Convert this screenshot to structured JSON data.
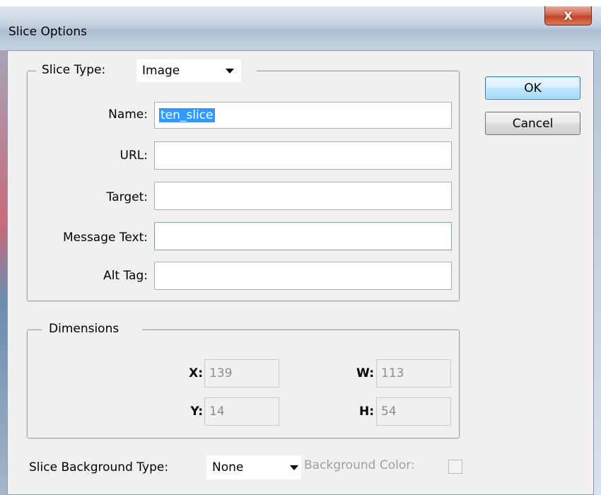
{
  "window": {
    "title": "Slice Options",
    "close_glyph": "X",
    "close_icon": "close-icon"
  },
  "slice_type": {
    "label": "Slice Type:",
    "value": "Image"
  },
  "fields": {
    "name": {
      "label": "Name:",
      "value": "ten_slice"
    },
    "url": {
      "label": "URL:",
      "value": ""
    },
    "target": {
      "label": "Target:",
      "value": ""
    },
    "message_text": {
      "label": "Message Text:",
      "value": ""
    },
    "alt_tag": {
      "label": "Alt Tag:",
      "value": ""
    }
  },
  "dimensions": {
    "title": "Dimensions",
    "x": {
      "label": "X:",
      "value": "139"
    },
    "y": {
      "label": "Y:",
      "value": "14"
    },
    "w": {
      "label": "W:",
      "value": "113"
    },
    "h": {
      "label": "H:",
      "value": "54"
    }
  },
  "background": {
    "type_label": "Slice Background Type:",
    "type_value": "None",
    "color_label": "Background Color:"
  },
  "buttons": {
    "ok": "OK",
    "cancel": "Cancel"
  }
}
